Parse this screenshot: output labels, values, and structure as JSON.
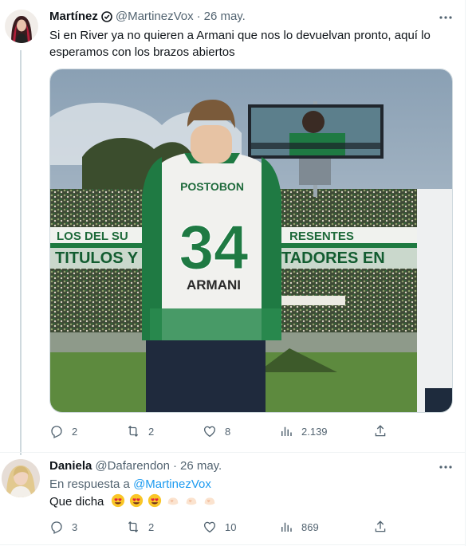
{
  "tweets": [
    {
      "name": "Martínez",
      "handle": "@MartinezVox",
      "separator": "·",
      "date": "26 may.",
      "text": "Si en River ya no quieren a Armani que nos lo devuelvan pronto, aquí lo esperamos con los brazos abiertos",
      "media": {
        "jersey_brand": "POSTOBON",
        "jersey_number": "34",
        "jersey_name": "ARMANI",
        "banner_top_left": "LOS DEL SU",
        "banner_top_right": "RESENTES",
        "banner_bottom_left": "TITULOS Y",
        "banner_bottom_right": "TADORES EN"
      },
      "stats": {
        "replies": "2",
        "retweets": "2",
        "likes": "8",
        "views": "2.139"
      }
    },
    {
      "name": "Daniela",
      "handle": "@Dafarendon",
      "separator": "·",
      "date": "26 may.",
      "reply_prefix": "En respuesta a",
      "reply_to": "@MartinezVox",
      "text": "Que dicha",
      "stats": {
        "replies": "3",
        "retweets": "2",
        "likes": "10",
        "views": "869"
      }
    }
  ],
  "icons": [
    "more-icon",
    "reply-icon",
    "retweet-icon",
    "like-icon",
    "views-icon",
    "share-icon",
    "verified-icon",
    "heart-eyes-emoji-icon",
    "heart-hands-emoji-icon"
  ],
  "colors": {
    "text": "#0f1419",
    "secondary": "#536471",
    "link": "#1d9bf0",
    "border": "#eff3f4"
  }
}
